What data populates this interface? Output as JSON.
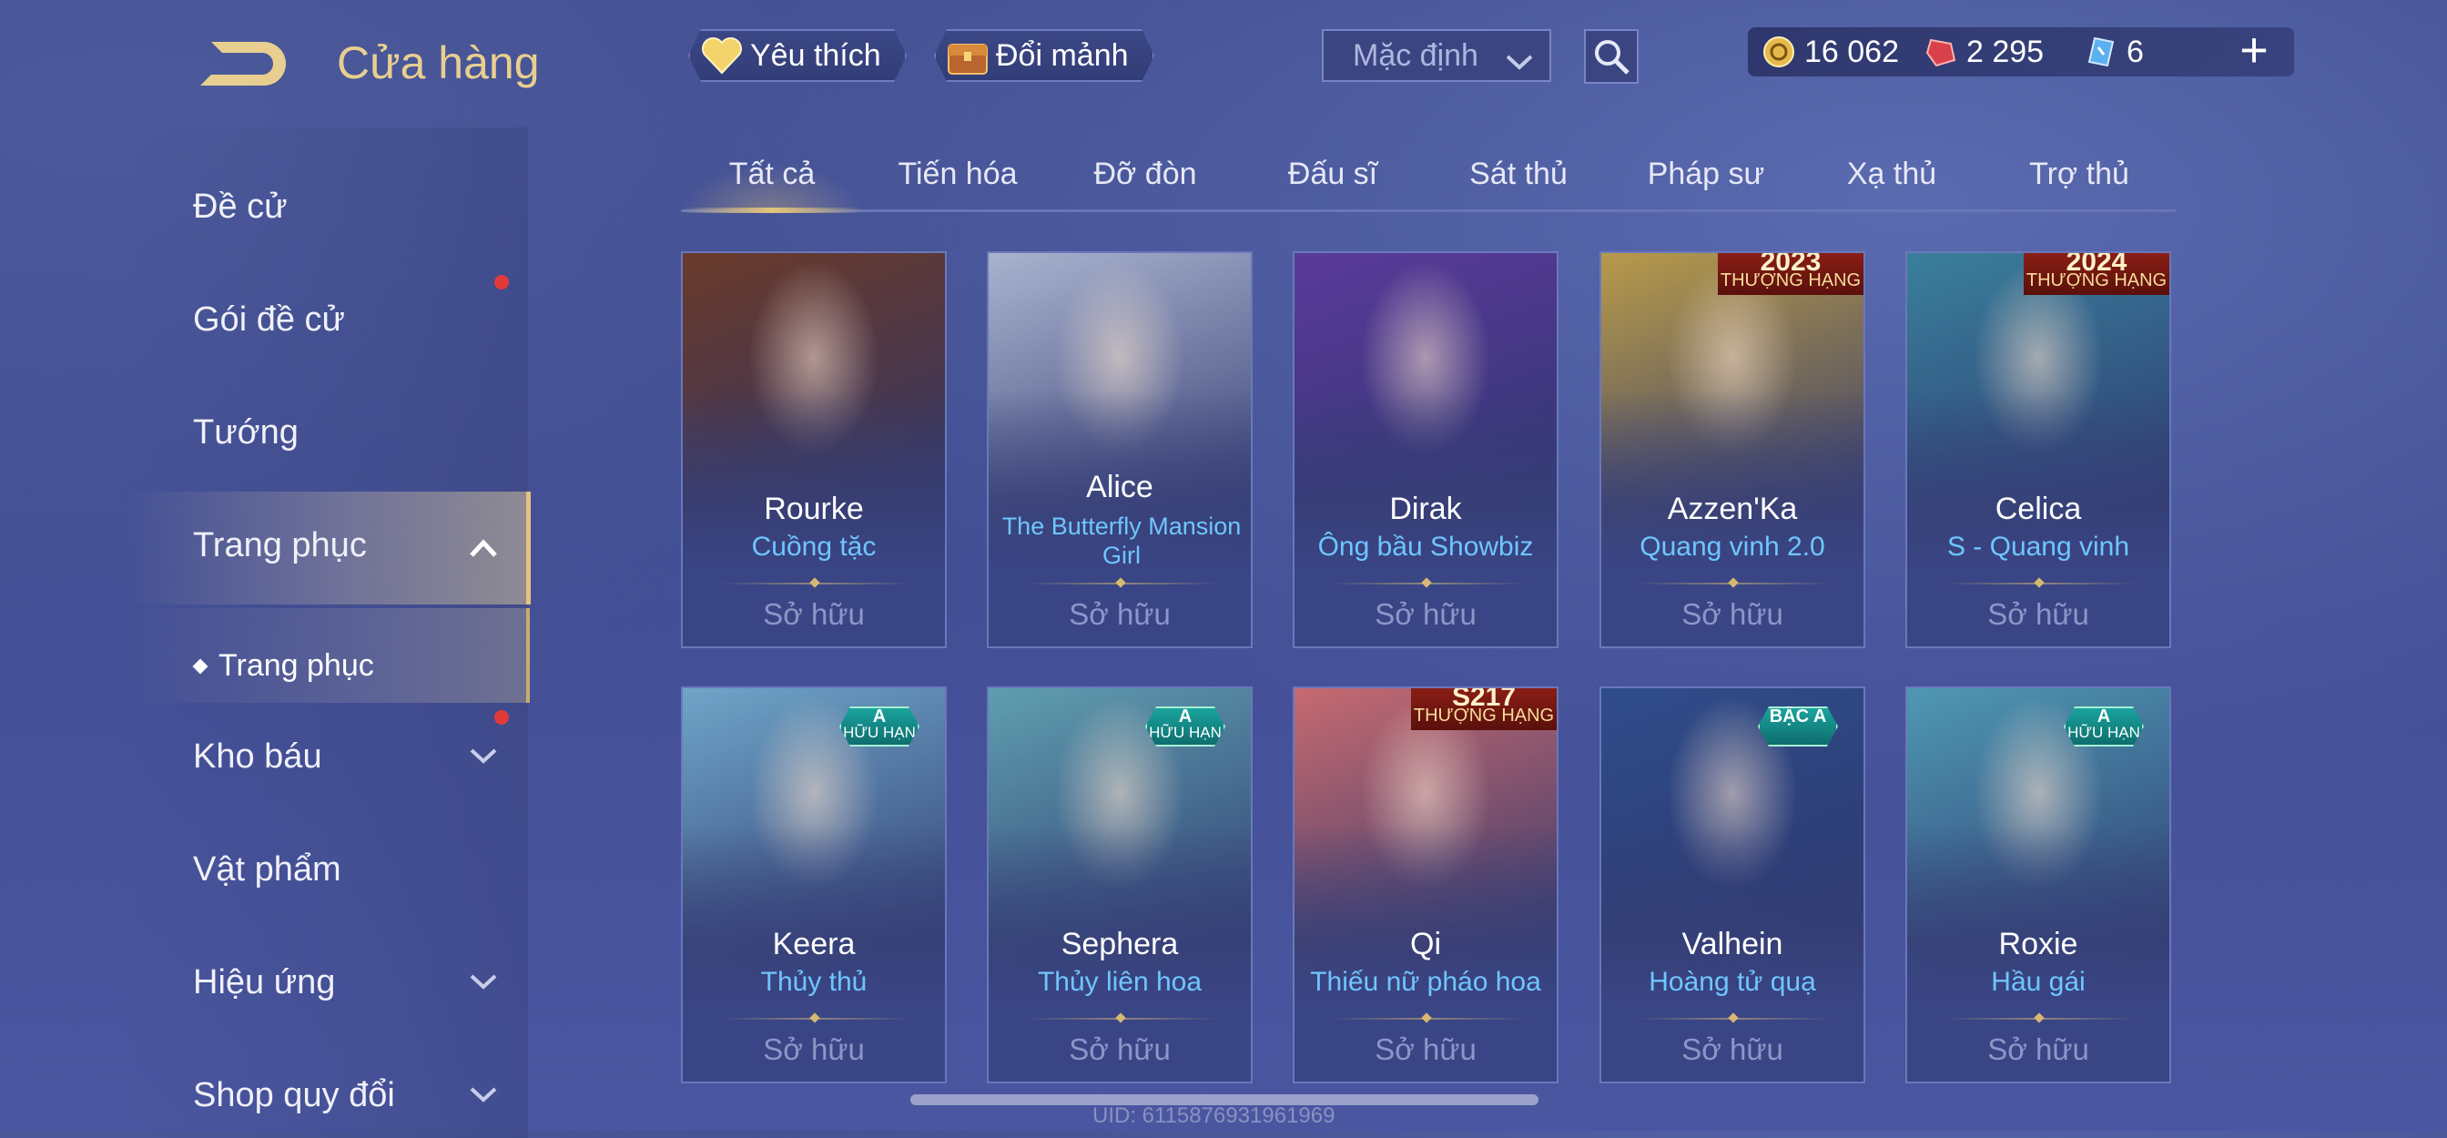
{
  "header": {
    "title": "Cửa hàng",
    "favorite_label": "Yêu thích",
    "exchange_label": "Đổi mảnh",
    "sort_value": "Mặc định"
  },
  "currency": {
    "gold": "16 062",
    "vouchers": "2 295",
    "tokens": "6"
  },
  "sidebar": {
    "items": [
      {
        "label": "Đề cử"
      },
      {
        "label": "Gói đề cử"
      },
      {
        "label": "Tướng"
      },
      {
        "label": "Trang phục"
      },
      {
        "label": "Kho báu"
      },
      {
        "label": "Vật phẩm"
      },
      {
        "label": "Hiệu ứng"
      },
      {
        "label": "Shop quy đổi"
      }
    ],
    "sub_item": "Trang phục"
  },
  "tabs": [
    "Tất cả",
    "Tiến hóa",
    "Đỡ đòn",
    "Đấu sĩ",
    "Sát thủ",
    "Pháp sư",
    "Xạ thủ",
    "Trợ thủ"
  ],
  "cards": [
    {
      "hero": "Rourke",
      "skin": "Cuồng tặc",
      "status": "Sở hữu",
      "art_color": "#6a3a2a"
    },
    {
      "hero": "Alice",
      "skin": "The Butterfly Mansion Girl",
      "status": "Sở hữu",
      "art_color": "#a9b3cf"
    },
    {
      "hero": "Dirak",
      "skin": "Ông bầu Showbiz",
      "status": "Sở hữu",
      "art_color": "#5a3a9a",
      "badge_top": ""
    },
    {
      "hero": "Azzen'Ka",
      "skin": "Quang vinh 2.0",
      "status": "Sở hữu",
      "art_color": "#b89a4a",
      "badge_top_line1": "THƯỢNG HẠNG",
      "badge_top_line2": "2023"
    },
    {
      "hero": "Celica",
      "skin": "S - Quang vinh",
      "status": "Sở hữu",
      "art_color": "#3a7f9c",
      "badge_top_line1": "THƯỢNG HẠNG",
      "badge_top_line2": "2024"
    },
    {
      "hero": "Keera",
      "skin": "Thủy thủ",
      "status": "Sở hữu",
      "art_color": "#6fa5c8",
      "badge_a_line1": "A",
      "badge_a_line2": "HỮU HẠN"
    },
    {
      "hero": "Sephera",
      "skin": "Thủy liên hoa",
      "status": "Sở hữu",
      "art_color": "#5f9eb0",
      "badge_a_line1": "A",
      "badge_a_line2": "HỮU HẠN"
    },
    {
      "hero": "Qi",
      "skin": "Thiếu nữ pháo hoa",
      "status": "Sở hữu",
      "art_color": "#c66a70",
      "badge_top_line1": "THƯỢNG HẠNG",
      "badge_top_line2": "S217"
    },
    {
      "hero": "Valhein",
      "skin": "Hoàng tử quạ",
      "status": "Sở hữu",
      "art_color": "#2f4d8a",
      "badge_a_line1": "BẬC A",
      "badge_a_line2": ""
    },
    {
      "hero": "Roxie",
      "skin": "Hầu gái",
      "status": "Sở hữu",
      "art_color": "#4f98b3",
      "badge_a_line1": "A",
      "badge_a_line2": "HỮU HẠN"
    }
  ],
  "footer": {
    "uid": "UID: 6115876931961969"
  }
}
